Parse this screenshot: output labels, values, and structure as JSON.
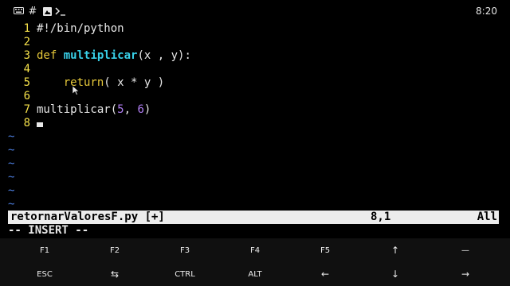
{
  "status_bar": {
    "left_icons": [
      "keyboard-icon",
      "hash-icon",
      "image-icon",
      "terminal-prompt-icon"
    ],
    "time": "8:20"
  },
  "editor": {
    "lines": [
      {
        "num": "1",
        "parts": [
          {
            "t": "#!/bin/python",
            "c": "plain"
          }
        ]
      },
      {
        "num": "2",
        "parts": []
      },
      {
        "num": "3",
        "parts": [
          {
            "t": "def",
            "c": "kw"
          },
          {
            "t": " ",
            "c": "plain"
          },
          {
            "t": "multiplicar",
            "c": "fn"
          },
          {
            "t": "(x , y):",
            "c": "plain"
          }
        ]
      },
      {
        "num": "4",
        "parts": []
      },
      {
        "num": "5",
        "parts": [
          {
            "t": "    ",
            "c": "plain"
          },
          {
            "t": "return",
            "c": "kw"
          },
          {
            "t": "( x * y )",
            "c": "plain"
          }
        ]
      },
      {
        "num": "6",
        "parts": []
      },
      {
        "num": "7",
        "parts": [
          {
            "t": "multiplicar(",
            "c": "plain"
          },
          {
            "t": "5",
            "c": "num"
          },
          {
            "t": ", ",
            "c": "plain"
          },
          {
            "t": "6",
            "c": "num"
          },
          {
            "t": ")",
            "c": "plain"
          }
        ]
      },
      {
        "num": "8",
        "parts": [],
        "cursor": true
      }
    ],
    "tilde": "~",
    "tilde_count": 6
  },
  "vim_status": {
    "filename": "retornarValoresF.py [+]",
    "position": "8,1",
    "scroll": "All"
  },
  "mode_line": "-- INSERT --",
  "extra_keys": {
    "row1": [
      "F1",
      "F2",
      "F3",
      "F4",
      "F5",
      "↑",
      "—"
    ],
    "row2": [
      "ESC",
      "⇆",
      "CTRL",
      "ALT",
      "←",
      "↓",
      "→"
    ]
  },
  "colors": {
    "line_number": "#f4e04a",
    "keyword": "#e6c83a",
    "function": "#38d0e8",
    "number": "#b07df2",
    "tilde": "#4d7fe0",
    "status_line_bg": "#ececec"
  }
}
